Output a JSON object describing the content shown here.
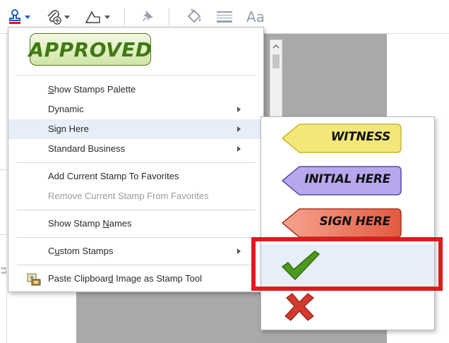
{
  "toolbar": {
    "tools": [
      {
        "name": "stamp-tool",
        "icon": "stamp-icon"
      },
      {
        "name": "attach-tool",
        "icon": "attach-icon"
      },
      {
        "name": "draw-tool",
        "icon": "shapes-icon"
      },
      {
        "name": "pin-tool",
        "icon": "pin-icon"
      },
      {
        "name": "fill-tool",
        "icon": "paint-bucket-icon"
      },
      {
        "name": "lines-tool",
        "icon": "lines-icon"
      },
      {
        "name": "text-properties-tool",
        "icon": "text-aa-icon",
        "text": "Aa"
      }
    ]
  },
  "stamp_menu": {
    "current_stamp": "APPROVED",
    "items": [
      {
        "label_pre": "",
        "label_u": "S",
        "label_post": "how Stamps Palette",
        "submenu": false,
        "enabled": true
      },
      {
        "label_pre": "Dynamic",
        "label_u": "",
        "label_post": "",
        "submenu": true,
        "enabled": true
      },
      {
        "label_pre": "Sign Here",
        "label_u": "",
        "label_post": "",
        "submenu": true,
        "enabled": true,
        "highlighted": true
      },
      {
        "label_pre": "Standard Business",
        "label_u": "",
        "label_post": "",
        "submenu": true,
        "enabled": true
      },
      {
        "label_pre": "Add Current Stamp To Favorites",
        "label_u": "",
        "label_post": "",
        "submenu": false,
        "enabled": true
      },
      {
        "label_pre": "Remove Current Stamp From Favorites",
        "label_u": "",
        "label_post": "",
        "submenu": false,
        "enabled": false
      },
      {
        "label_pre": "Show Stamp ",
        "label_u": "N",
        "label_post": "ames",
        "submenu": false,
        "enabled": true
      },
      {
        "label_pre": "C",
        "label_u": "u",
        "label_post": "stom Stamps",
        "submenu": true,
        "enabled": true
      },
      {
        "label_pre": "Paste Clipboar",
        "label_u": "d",
        "label_post": " Image as Stamp Tool",
        "submenu": false,
        "enabled": true,
        "icon": "paste-image-icon"
      }
    ]
  },
  "sign_here_submenu": {
    "items": [
      {
        "label": "WITNESS",
        "color": "#f4e77a",
        "border": "#c9b52e"
      },
      {
        "label": "INITIAL HERE",
        "color": "#b7a8ee",
        "border": "#5a49a8"
      },
      {
        "label": "SIGN HERE",
        "color": "#ee7a63",
        "border": "#a8321f"
      },
      {
        "label": "",
        "icon": "checkmark-icon",
        "color": "#4e9a1f",
        "highlighted": true
      },
      {
        "label": "",
        "icon": "x-mark-icon",
        "color": "#d33a2c"
      }
    ]
  },
  "colors": {
    "highlight": "#e6eef8",
    "callout_box": "#e0191c",
    "approved_green": "#3f7a12"
  },
  "doc_fragment": {
    "line1": "Intr",
    "line2": "eof"
  }
}
